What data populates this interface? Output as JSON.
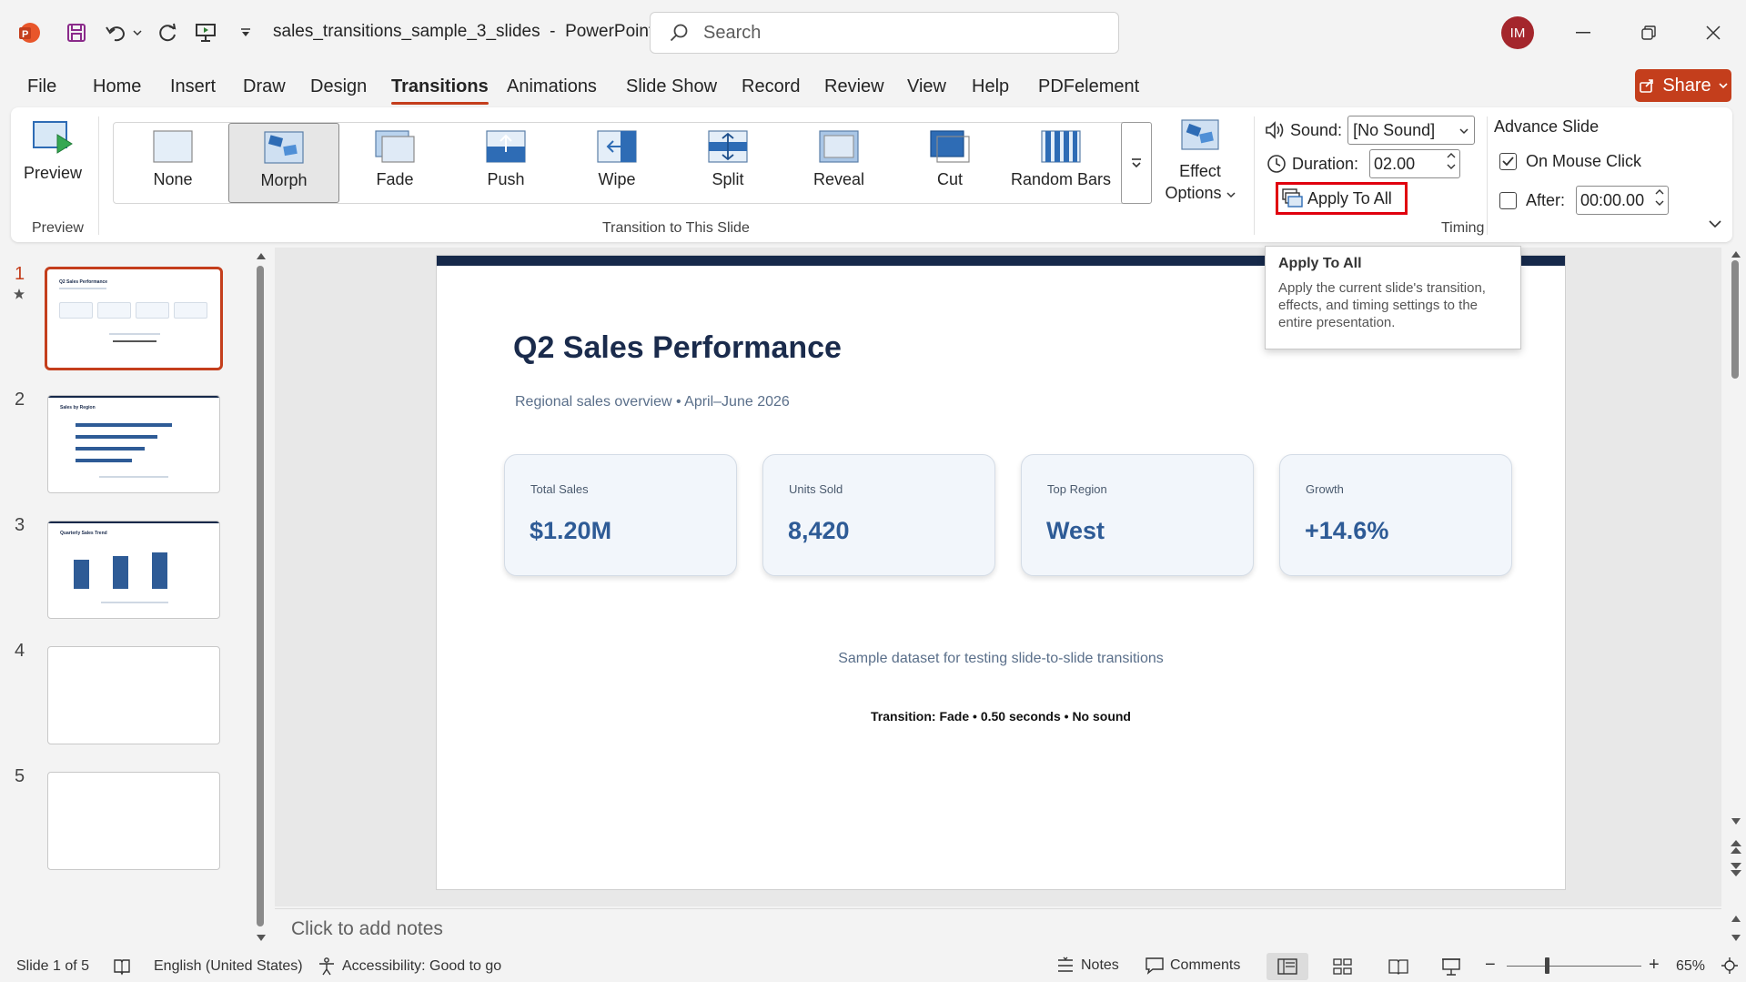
{
  "titlebar": {
    "doc_name": "sales_transitions_sample_3_slides",
    "app_name": "PowerPoint",
    "separator": "-",
    "search_placeholder": "Search",
    "user_initials": "IM"
  },
  "tabs": [
    "File",
    "Home",
    "Insert",
    "Draw",
    "Design",
    "Transitions",
    "Animations",
    "Slide Show",
    "Record",
    "Review",
    "View",
    "Help",
    "PDFelement"
  ],
  "active_tab": "Transitions",
  "share_label": "Share",
  "ribbon": {
    "preview_label": "Preview",
    "preview_group": "Preview",
    "transitions": [
      "None",
      "Morph",
      "Fade",
      "Push",
      "Wipe",
      "Split",
      "Reveal",
      "Cut",
      "Random Bars"
    ],
    "selected_transition": "Morph",
    "effect_options_line1": "Effect",
    "effect_options_line2": "Options",
    "transition_group": "Transition to This Slide",
    "sound_label": "Sound:",
    "sound_value": "[No Sound]",
    "duration_label": "Duration:",
    "duration_value": "02.00",
    "apply_all_label": "Apply To All",
    "advance_label": "Advance Slide",
    "on_click_label": "On Mouse Click",
    "on_click_checked": true,
    "after_label": "After:",
    "after_checked": false,
    "after_value": "00:00.00",
    "timing_group": "Timing"
  },
  "tooltip": {
    "title": "Apply To All",
    "body": "Apply the current slide's transition, effects, and timing settings to the entire presentation."
  },
  "thumbnails": {
    "numbers": [
      "1",
      "2",
      "3",
      "4",
      "5"
    ],
    "selected": "1",
    "t1_title": "Q2 Sales Performance",
    "t2_title": "Sales by Region",
    "t3_title": "Quarterly Sales Trend"
  },
  "slide": {
    "title": "Q2 Sales Performance",
    "subtitle": "Regional sales overview • April–June 2026",
    "kpis": [
      {
        "label": "Total Sales",
        "value": "$1.20M"
      },
      {
        "label": "Units Sold",
        "value": "8,420"
      },
      {
        "label": "Top Region",
        "value": "West"
      },
      {
        "label": "Growth",
        "value": "+14.6%"
      }
    ],
    "footnote": "Sample dataset for testing slide-to-slide transitions",
    "transition_note": "Transition: Fade • 0.50 seconds • No sound"
  },
  "notes_placeholder": "Click to add notes",
  "status": {
    "slide_info": "Slide 1 of 5",
    "language": "English (United States)",
    "accessibility": "Accessibility: Good to go",
    "notes_label": "Notes",
    "comments_label": "Comments",
    "zoom": "65%"
  },
  "colors": {
    "accent": "#c43e1c",
    "slide_navy": "#16294a",
    "kpi_blue": "#2e5b96",
    "highlight_red": "#e0000e"
  }
}
